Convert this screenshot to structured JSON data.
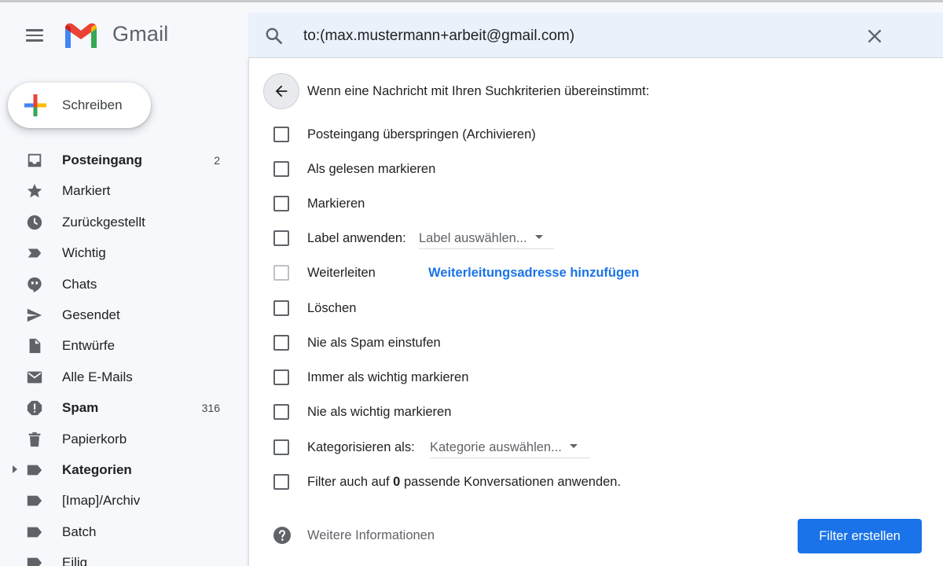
{
  "app": {
    "name": "Gmail"
  },
  "search": {
    "value": "to:(max.mustermann+arbeit@gmail.com)"
  },
  "compose": {
    "label": "Schreiben"
  },
  "sidebar": {
    "items": [
      {
        "label": "Posteingang",
        "count": "2",
        "bold": true,
        "icon": "inbox-icon"
      },
      {
        "label": "Markiert",
        "count": "",
        "bold": false,
        "icon": "star-icon"
      },
      {
        "label": "Zurückgestellt",
        "count": "",
        "bold": false,
        "icon": "clock-icon"
      },
      {
        "label": "Wichtig",
        "count": "",
        "bold": false,
        "icon": "important-icon"
      },
      {
        "label": "Chats",
        "count": "",
        "bold": false,
        "icon": "chat-icon"
      },
      {
        "label": "Gesendet",
        "count": "",
        "bold": false,
        "icon": "send-icon"
      },
      {
        "label": "Entwürfe",
        "count": "",
        "bold": false,
        "icon": "draft-icon"
      },
      {
        "label": "Alle E-Mails",
        "count": "",
        "bold": false,
        "icon": "mail-icon"
      },
      {
        "label": "Spam",
        "count": "316",
        "bold": true,
        "icon": "spam-icon"
      },
      {
        "label": "Papierkorb",
        "count": "",
        "bold": false,
        "icon": "trash-icon"
      },
      {
        "label": "Kategorien",
        "count": "",
        "bold": true,
        "icon": "label-icon"
      },
      {
        "label": "[Imap]/Archiv",
        "count": "",
        "bold": false,
        "icon": "label-icon"
      },
      {
        "label": "Batch",
        "count": "",
        "bold": false,
        "icon": "label-icon"
      },
      {
        "label": "Eilig",
        "count": "",
        "bold": false,
        "icon": "label-icon"
      }
    ]
  },
  "filter": {
    "heading": "Wenn eine Nachricht mit Ihren Suchkriterien übereinstimmt:",
    "options": {
      "skip_inbox": "Posteingang überspringen (Archivieren)",
      "mark_read": "Als gelesen markieren",
      "star": "Markieren",
      "apply_label": "Label anwenden:",
      "label_select": "Label auswählen...",
      "forward": "Weiterleiten",
      "forward_link": "Weiterleitungsadresse hinzufügen",
      "delete": "Löschen",
      "never_spam": "Nie als Spam einstufen",
      "always_important": "Immer als wichtig markieren",
      "never_important": "Nie als wichtig markieren",
      "categorize": "Kategorisieren als:",
      "category_select": "Kategorie auswählen...",
      "also_apply_prefix": "Filter auch auf",
      "also_apply_count": "0",
      "also_apply_suffix": "passende Konversationen anwenden."
    },
    "help": "Weitere Informationen",
    "create_button": "Filter erstellen"
  },
  "colors": {
    "accent": "#1a73e8",
    "sidebar_bg": "#f6f8fc",
    "search_bg": "#eaf1fb"
  }
}
